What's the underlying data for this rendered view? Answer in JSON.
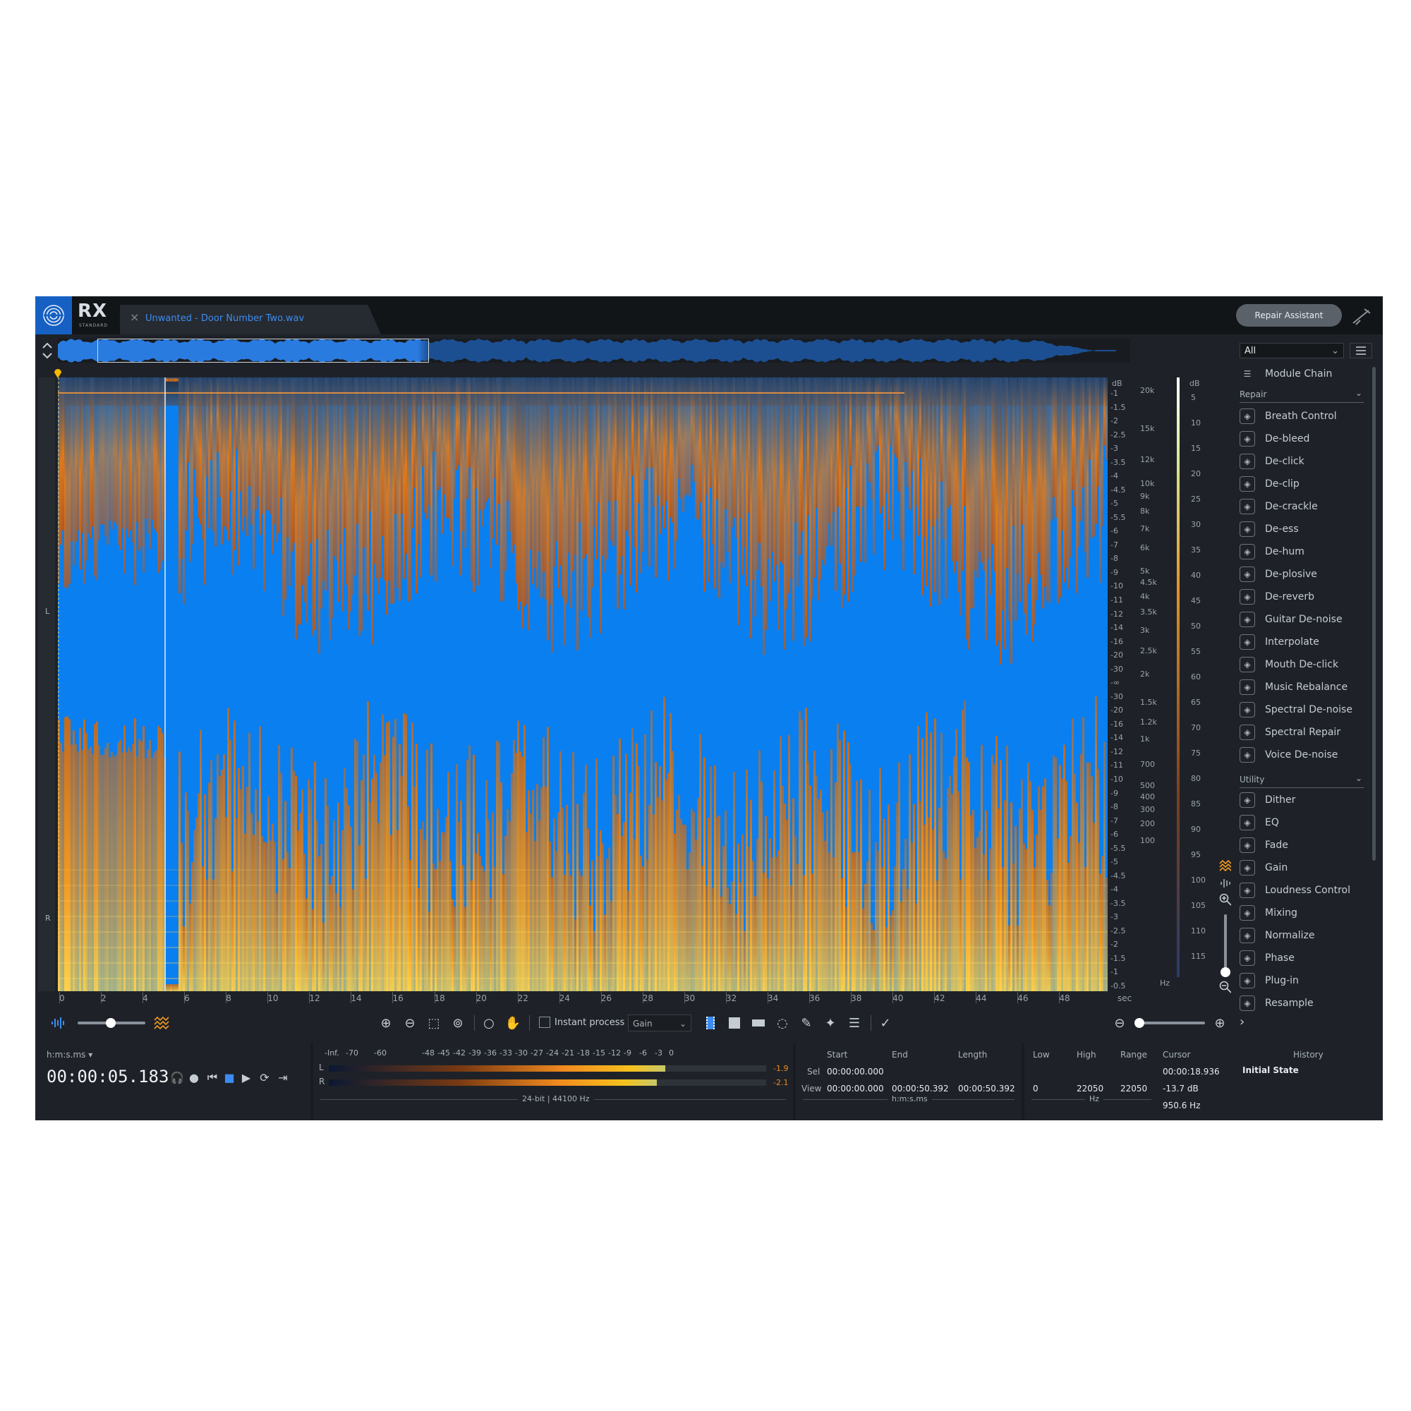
{
  "app": {
    "name": "RX",
    "edition": "STANDARD",
    "file_tab": "Unwanted - Door Number Two.wav",
    "repair_assistant": "Repair Assistant"
  },
  "channels": {
    "left": "L",
    "right": "R"
  },
  "axis": {
    "db_label": "dB",
    "db_ticks": [
      "-1",
      "-1.5",
      "-2",
      "-2.5",
      "-3",
      "-3.5",
      "-4",
      "-4.5",
      "-5",
      "-5.5",
      "-6",
      "-7",
      "-8",
      "-9",
      "-10",
      "-11",
      "-12",
      "-14",
      "-16",
      "-20",
      "-30",
      "-∞",
      "-30",
      "-20",
      "-16",
      "-14",
      "-12",
      "-11",
      "-10",
      "-9",
      "-8",
      "-7",
      "-6",
      "-5.5",
      "-5",
      "-4.5",
      "-4",
      "-3.5",
      "-3",
      "-2.5",
      "-2",
      "-1.5",
      "-1",
      "-0.5"
    ],
    "hz_ticks": [
      "20k",
      "15k",
      "12k",
      "10k",
      "9k",
      "8k",
      "7k",
      "6k",
      "5k",
      "4.5k",
      "4k",
      "3.5k",
      "3k",
      "2.5k",
      "2k",
      "1.5k",
      "1.2k",
      "1k",
      "700",
      "500",
      "400",
      "300",
      "200",
      "100"
    ],
    "hz_unit": "Hz",
    "meter_db_label": "dB",
    "meter_ticks": [
      "5",
      "10",
      "15",
      "20",
      "25",
      "30",
      "35",
      "40",
      "45",
      "50",
      "55",
      "60",
      "65",
      "70",
      "75",
      "80",
      "85",
      "90",
      "95",
      "100",
      "105",
      "110",
      "115"
    ],
    "time_ticks": [
      "0",
      "2",
      "4",
      "6",
      "8",
      "10",
      "12",
      "14",
      "16",
      "18",
      "20",
      "22",
      "24",
      "26",
      "28",
      "30",
      "32",
      "34",
      "36",
      "38",
      "40",
      "42",
      "44",
      "46",
      "48"
    ],
    "time_unit": "sec"
  },
  "toolbar": {
    "instant_process": "Instant process",
    "gain_mode": "Gain"
  },
  "transport": {
    "time_format": "h:m:s.ms",
    "time": "00:00:05.183"
  },
  "meter": {
    "scale": [
      "-Inf.",
      "-70",
      "-60",
      "-48",
      "-45",
      "-42",
      "-39",
      "-36",
      "-33",
      "-30",
      "-27",
      "-24",
      "-21",
      "-18",
      "-15",
      "-12",
      "-9",
      "-6",
      "-3",
      "0"
    ],
    "left_label": "L",
    "right_label": "R",
    "left_peak": "-1.9",
    "right_peak": "-2.1",
    "left_level": 0.77,
    "right_level": 0.75,
    "format": "24-bit | 44100 Hz"
  },
  "selection": {
    "headers": [
      "Start",
      "End",
      "Length"
    ],
    "sel_label": "Sel",
    "view_label": "View",
    "sel_start": "00:00:00.000",
    "view_start": "00:00:00.000",
    "view_end": "00:00:50.392",
    "view_length": "00:00:50.392",
    "unit": "h:m:s.ms"
  },
  "frequency": {
    "headers": [
      "Low",
      "High",
      "Range"
    ],
    "low": "0",
    "high": "22050",
    "range": "22050",
    "unit": "Hz"
  },
  "cursor": {
    "header": "Cursor",
    "time": "00:00:18.936",
    "level": "-13.7 dB",
    "freq": "950.6 Hz"
  },
  "modules": {
    "filter": "All",
    "module_chain": "Module Chain",
    "repair_section": "Repair",
    "repair": [
      "Breath Control",
      "De-bleed",
      "De-click",
      "De-clip",
      "De-crackle",
      "De-ess",
      "De-hum",
      "De-plosive",
      "De-reverb",
      "Guitar De-noise",
      "Interpolate",
      "Mouth De-click",
      "Music Rebalance",
      "Spectral De-noise",
      "Spectral Repair",
      "Voice De-noise"
    ],
    "utility_section": "Utility",
    "utility": [
      "Dither",
      "EQ",
      "Fade",
      "Gain",
      "Loudness Control",
      "Mixing",
      "Normalize",
      "Phase",
      "Plug-in",
      "Resample"
    ]
  },
  "history": {
    "title": "History",
    "items": [
      "Initial State"
    ]
  },
  "colors": {
    "accent": "#1660c4",
    "spectrogram_bg": "#0a7ff0",
    "spectrogram_hot": "#ff9a1a"
  }
}
